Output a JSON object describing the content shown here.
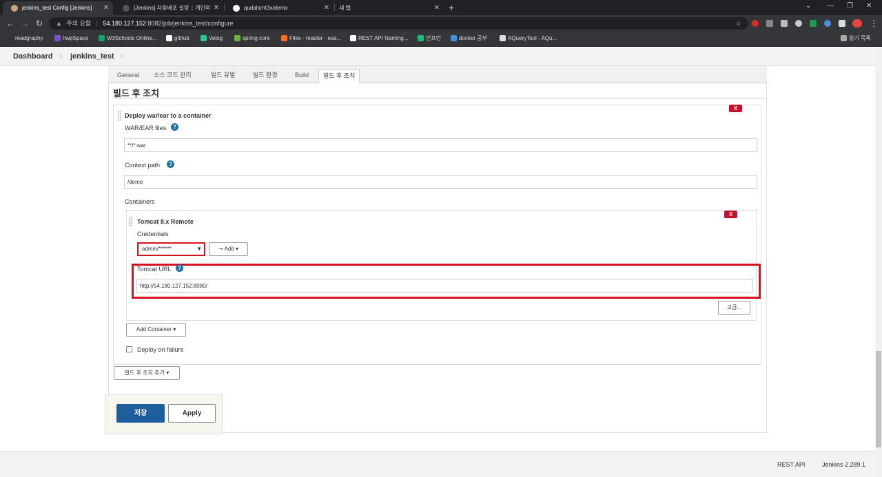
{
  "browser": {
    "tabs": [
      {
        "title": "jenkins_test Config [Jenkins]",
        "active": true
      },
      {
        "title": "[Jenkins] 자동배포 설정 :: 개인의",
        "active": false
      },
      {
        "title": "qudalsrnt3x/demo",
        "active": false
      },
      {
        "title": "새 탭",
        "active": false
      }
    ],
    "new_tab_symbol": "+",
    "address": {
      "security_label": "주의 요함",
      "host": "54.180.127.152",
      "rest": ":8082/job/jenkins_test/configure"
    },
    "bookmarks": [
      {
        "label": "readgraphy",
        "color": "#333333"
      },
      {
        "label": "hwpSpace",
        "color": "#7b4fd6"
      },
      {
        "label": "W3Schools Online...",
        "color": "#04aa6d"
      },
      {
        "label": "github",
        "color": "#ffffff"
      },
      {
        "label": "Velog",
        "color": "#20c997"
      },
      {
        "label": "spring core",
        "color": "#6db33f"
      },
      {
        "label": "Files · master · eas...",
        "color": "#fc6d26"
      },
      {
        "label": "REST API Naming...",
        "color": "#ffffff"
      },
      {
        "label": "인프런",
        "color": "#1dc078"
      },
      {
        "label": "docker 공부",
        "color": "#4a90d9"
      },
      {
        "label": "AQueryTool - AQu...",
        "color": "#dddddd"
      }
    ],
    "reading_list_label": "읽기 목록"
  },
  "breadcrumb": {
    "items": [
      "Dashboard",
      "jenkins_test"
    ],
    "separator": "›"
  },
  "config_tabs": [
    "General",
    "소스 코드 관리",
    "빌드 유발",
    "빌드 환경",
    "Build",
    "빌드 후 조치"
  ],
  "section_title": "빌드 후 조치",
  "deploy_step": {
    "title": "Deploy war/ear to a container",
    "delete_label": "X",
    "war_label": "WAR/EAR files",
    "war_value": "**/*.war",
    "context_label": "Context path",
    "context_value": "/demo",
    "containers_label": "Containers",
    "help_symbol": "?",
    "container": {
      "title": "Tomcat 8.x Remote",
      "delete_label": "X",
      "credentials_label": "Credentials",
      "credentials_value": "admin/******",
      "add_label": "Add",
      "url_label": "Tomcat URL",
      "url_value": "http://54.180.127.152:8080/",
      "advanced_label": "고급..."
    },
    "add_container_label": "Add Container",
    "deploy_on_failure_label": "Deploy on failure",
    "deploy_on_failure_checked": false
  },
  "add_post_build_label": "빌드 후 조치 추가",
  "save_label": "저장",
  "apply_label": "Apply",
  "footer": {
    "rest_api": "REST API",
    "version": "Jenkins 2.289.1"
  }
}
